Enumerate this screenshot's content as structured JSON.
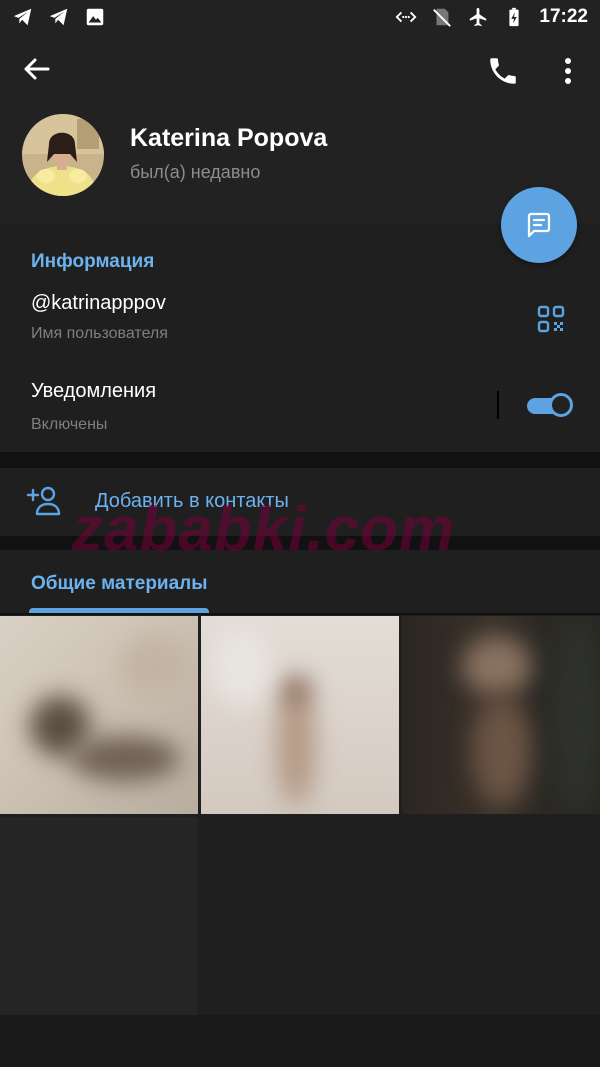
{
  "status_bar": {
    "time": "17:22",
    "left_icons": [
      "telegram-icon",
      "telegram-icon",
      "image-icon"
    ],
    "right_icons": [
      "data-saver-icon",
      "no-sim-icon",
      "airplane-icon",
      "battery-charging-icon"
    ]
  },
  "header": {
    "name": "Katerina Popova",
    "status": "был(а) недавно"
  },
  "info": {
    "section_title": "Информация",
    "username": "@katrinapppov",
    "username_label": "Имя пользователя",
    "notifications_title": "Уведомления",
    "notifications_status": "Включены",
    "notifications_enabled": true
  },
  "actions": {
    "add_contact_label": "Добавить в контакты"
  },
  "media": {
    "section_title": "Общие материалы"
  },
  "watermark": "zababki.com",
  "colors": {
    "accent": "#5da2e1",
    "accent_text": "#6db2ef",
    "background": "#1f1f1f",
    "header": "#222222"
  }
}
